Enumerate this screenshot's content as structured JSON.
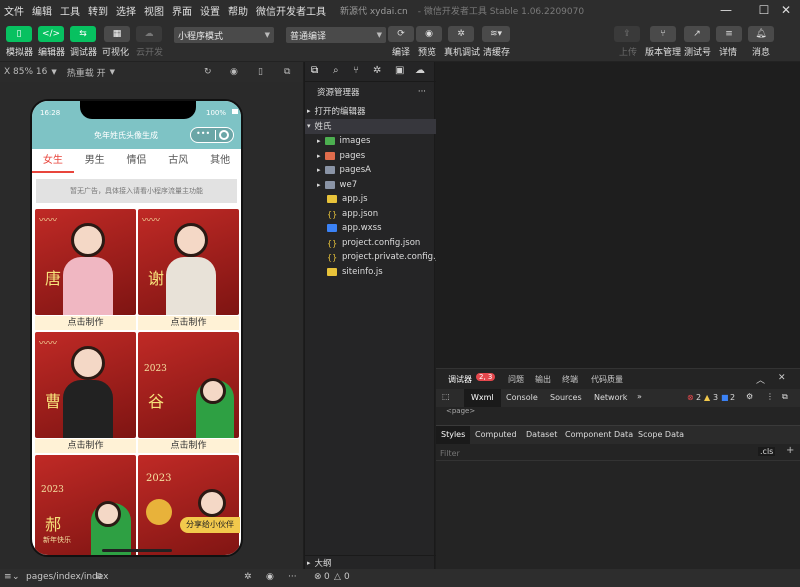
{
  "menu": [
    "文件",
    "编辑",
    "工具",
    "转到",
    "选择",
    "视图",
    "界面",
    "设置",
    "帮助",
    "微信开发者工具"
  ],
  "window_title": "新源代 xydai.cn",
  "window_subtitle": "- 微信开发者工具 Stable 1.06.2209070",
  "toolbar": {
    "left_buttons": [
      "模拟器",
      "编辑器",
      "调试器",
      "可视化",
      "云开发"
    ],
    "mode_select": "小程序模式",
    "compile_select": "普通编译",
    "center_buttons": [
      "编译",
      "预览",
      "真机调试",
      "清缓存"
    ],
    "right_buttons": [
      "上传",
      "版本管理",
      "测试号",
      "详情",
      "消息"
    ]
  },
  "simulator": {
    "device_info": "X 85% 16",
    "hotreload": "热重载 开",
    "phone": {
      "time": "16:28",
      "battery": "100%",
      "app_title": "免年姓氏头像生成",
      "tabs": [
        "女生",
        "男生",
        "情侣",
        "古风",
        "其他"
      ],
      "active_tab": "女生",
      "ad_text": "暂无广告，具体接入请看小程序流量主功能",
      "cards": [
        {
          "char": "唐",
          "button": "点击制作"
        },
        {
          "char": "谢",
          "button": "点击制作"
        },
        {
          "char": "曹",
          "button": "点击制作"
        },
        {
          "char": "谷",
          "button": "点击制作"
        },
        {
          "char": "郝",
          "button": ""
        },
        {
          "char": "",
          "button": ""
        }
      ],
      "card_texts": [
        "2023",
        "新年快乐"
      ],
      "share_button": "分享给小伙伴"
    }
  },
  "explorer": {
    "title": "资源管理器",
    "open_editors": "打开的编辑器",
    "project": "姓氏",
    "items": [
      {
        "name": "images",
        "type": "folder-img"
      },
      {
        "name": "pages",
        "type": "folder-pages"
      },
      {
        "name": "pagesA",
        "type": "folder"
      },
      {
        "name": "we7",
        "type": "folder"
      },
      {
        "name": "app.js",
        "type": "js"
      },
      {
        "name": "app.json",
        "type": "json"
      },
      {
        "name": "app.wxss",
        "type": "wxss"
      },
      {
        "name": "project.config.json",
        "type": "json"
      },
      {
        "name": "project.private.config.js...",
        "type": "json"
      },
      {
        "name": "siteinfo.js",
        "type": "js"
      }
    ],
    "outline": "大纲"
  },
  "devtools": {
    "tabs": [
      "调试器",
      "问题",
      "输出",
      "终端",
      "代码质量"
    ],
    "badge": "2, 3",
    "subtabs": [
      "Wxml",
      "Console",
      "Sources",
      "Network"
    ],
    "errors": "2",
    "warnings": "3",
    "infos": "2",
    "page_tag": "<page>",
    "style_tabs": [
      "Styles",
      "Computed",
      "Dataset",
      "Component Data",
      "Scope Data"
    ],
    "filter_placeholder": "Filter",
    "cls": ".cls"
  },
  "statusbar": {
    "path": "pages/index/index",
    "errors": "0",
    "warnings": "0"
  }
}
